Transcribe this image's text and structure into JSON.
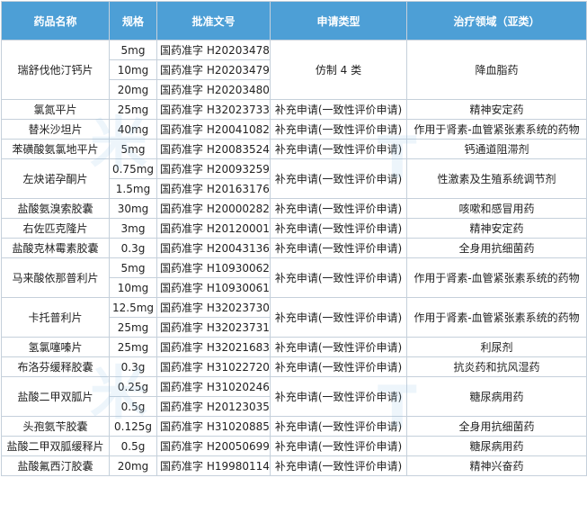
{
  "columns": [
    {
      "key": "name",
      "label": "药品名称",
      "width": 120
    },
    {
      "key": "spec",
      "label": "规格",
      "width": 53
    },
    {
      "key": "approval",
      "label": "批准文号",
      "width": 126
    },
    {
      "key": "type",
      "label": "申请类型",
      "width": 152
    },
    {
      "key": "area",
      "label": "治疗领域（亚类）",
      "width": 200
    }
  ],
  "groups": [
    {
      "name": "瑞舒伐他汀钙片",
      "type": "仿制 4 类",
      "area": "降血脂药",
      "rows": [
        {
          "spec": "5mg",
          "approval": "国药准字 H20203478"
        },
        {
          "spec": "10mg",
          "approval": "国药准字 H20203479"
        },
        {
          "spec": "20mg",
          "approval": "国药准字 H20203480"
        }
      ]
    },
    {
      "name": "氯氮平片",
      "type": "补充申请(一致性评价申请)",
      "area": "精神安定药",
      "rows": [
        {
          "spec": "25mg",
          "approval": "国药准字 H32023733"
        }
      ]
    },
    {
      "name": "替米沙坦片",
      "type": "补充申请(一致性评价申请)",
      "area": "作用于肾素-血管紧张素系统的药物",
      "rows": [
        {
          "spec": "40mg",
          "approval": "国药准字 H20041082"
        }
      ]
    },
    {
      "name": "苯磺酸氨氯地平片",
      "type": "补充申请(一致性评价申请)",
      "area": "钙通道阻滞剂",
      "rows": [
        {
          "spec": "5mg",
          "approval": "国药准字 H20083524"
        }
      ]
    },
    {
      "name": "左炔诺孕酮片",
      "type": "补充申请(一致性评价申请)",
      "area": "性激素及生殖系统调节剂",
      "rows": [
        {
          "spec": "0.75mg",
          "approval": "国药准字 H20093259"
        },
        {
          "spec": "1.5mg",
          "approval": "国药准字 H20163176"
        }
      ]
    },
    {
      "name": "盐酸氨溴索胶囊",
      "type": "补充申请(一致性评价申请)",
      "area": "咳嗽和感冒用药",
      "rows": [
        {
          "spec": "30mg",
          "approval": "国药准字 H20000282"
        }
      ]
    },
    {
      "name": "右佐匹克隆片",
      "type": "补充申请(一致性评价申请)",
      "area": "精神安定药",
      "rows": [
        {
          "spec": "3mg",
          "approval": "国药准字 H20120001"
        }
      ]
    },
    {
      "name": "盐酸克林霉素胶囊",
      "type": "补充申请(一致性评价申请)",
      "area": "全身用抗细菌药",
      "rows": [
        {
          "spec": "0.3g",
          "approval": "国药准字 H20043136"
        }
      ]
    },
    {
      "name": "马来酸依那普利片",
      "type": "补充申请(一致性评价申请)",
      "area": "作用于肾素-血管紧张素系统的药物",
      "rows": [
        {
          "spec": "5mg",
          "approval": "国药准字 H10930062"
        },
        {
          "spec": "10mg",
          "approval": "国药准字 H10930061"
        }
      ]
    },
    {
      "name": "卡托普利片",
      "type": "补充申请(一致性评价申请)",
      "area": "作用于肾素-血管紧张素系统的药物",
      "rows": [
        {
          "spec": "12.5mg",
          "approval": "国药准字 H32023730"
        },
        {
          "spec": "25mg",
          "approval": "国药准字 H32023731"
        }
      ]
    },
    {
      "name": "氢氯噻嗪片",
      "type": "补充申请(一致性评价申请)",
      "area": "利尿剂",
      "rows": [
        {
          "spec": "25mg",
          "approval": "国药准字 H32021683"
        }
      ]
    },
    {
      "name": "布洛芬缓释胶囊",
      "type": "补充申请(一致性评价申请)",
      "area": "抗炎药和抗风湿药",
      "rows": [
        {
          "spec": "0.3g",
          "approval": "国药准字 H31022720"
        }
      ]
    },
    {
      "name": "盐酸二甲双胍片",
      "type": "补充申请(一致性评价申请)",
      "area": "糖尿病用药",
      "rows": [
        {
          "spec": "0.25g",
          "approval": "国药准字 H31020246"
        },
        {
          "spec": "0.5g",
          "approval": "国药准字 H20123035"
        }
      ]
    },
    {
      "name": "头孢氨苄胶囊",
      "type": "补充申请(一致性评价申请)",
      "area": "全身用抗细菌药",
      "rows": [
        {
          "spec": "0.125g",
          "approval": "国药准字 H31020885"
        }
      ]
    },
    {
      "name": "盐酸二甲双胍缓释片",
      "type": "补充申请(一致性评价申请)",
      "area": "糖尿病用药",
      "rows": [
        {
          "spec": "0.5g",
          "approval": "国药准字 H20050699"
        }
      ]
    },
    {
      "name": "盐酸氟西汀胶囊",
      "type": "补充申请(一致性评价申请)",
      "area": "精神兴奋药",
      "rows": [
        {
          "spec": "20mg",
          "approval": "国药准字 H19980114"
        }
      ]
    }
  ],
  "colors": {
    "header_bg": "#4d9fd6",
    "header_text": "#ffffff",
    "border": "#c5d0db",
    "watermark": "#8cbee6"
  }
}
